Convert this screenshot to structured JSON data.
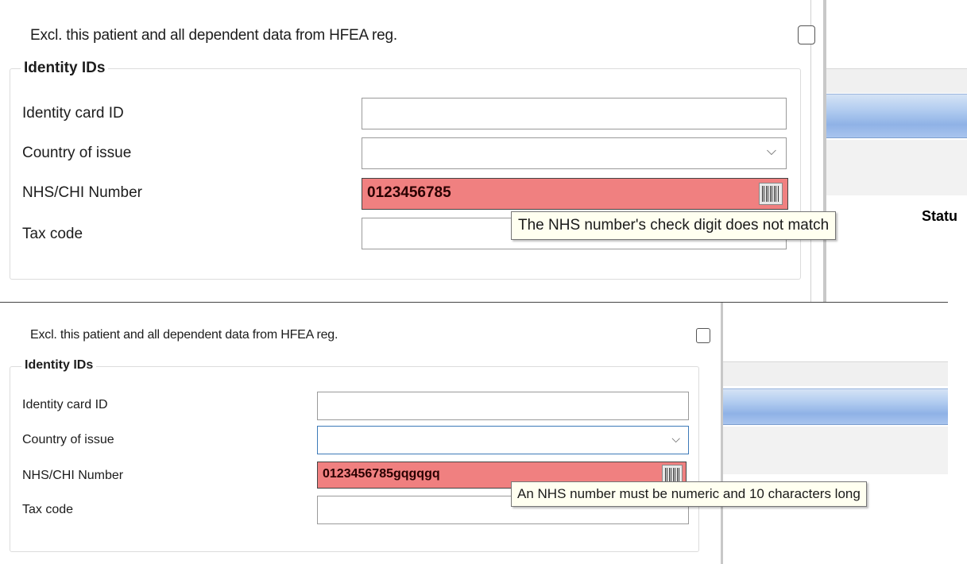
{
  "top": {
    "exclude_label": "Excl. this patient and all dependent data from HFEA reg.",
    "group_title": "Identity IDs",
    "fields": {
      "identity_card_label": "Identity card ID",
      "country_label": "Country of issue",
      "nhs_label": "NHS/CHI Number",
      "tax_label": "Tax code"
    },
    "nhs_value": "0123456785",
    "tooltip": "The NHS number's check digit does not match",
    "status_fragment": "Statu"
  },
  "bottom": {
    "exclude_label": "Excl. this patient and all dependent data from HFEA reg.",
    "group_title": "Identity IDs",
    "fields": {
      "identity_card_label": "Identity card ID",
      "country_label": "Country of issue",
      "nhs_label": "NHS/CHI Number",
      "tax_label": "Tax code"
    },
    "nhs_value": "0123456785gqgqgq",
    "tooltip": "An NHS number must be numeric and 10 characters long"
  },
  "icons": {
    "select_arrow": "⌵",
    "barcode_icon": "barcode-scanner-icon"
  },
  "colors": {
    "error_field": "#f08080",
    "tooltip_bg": "#fffff0",
    "highlight_row": "#8fb2e6"
  }
}
